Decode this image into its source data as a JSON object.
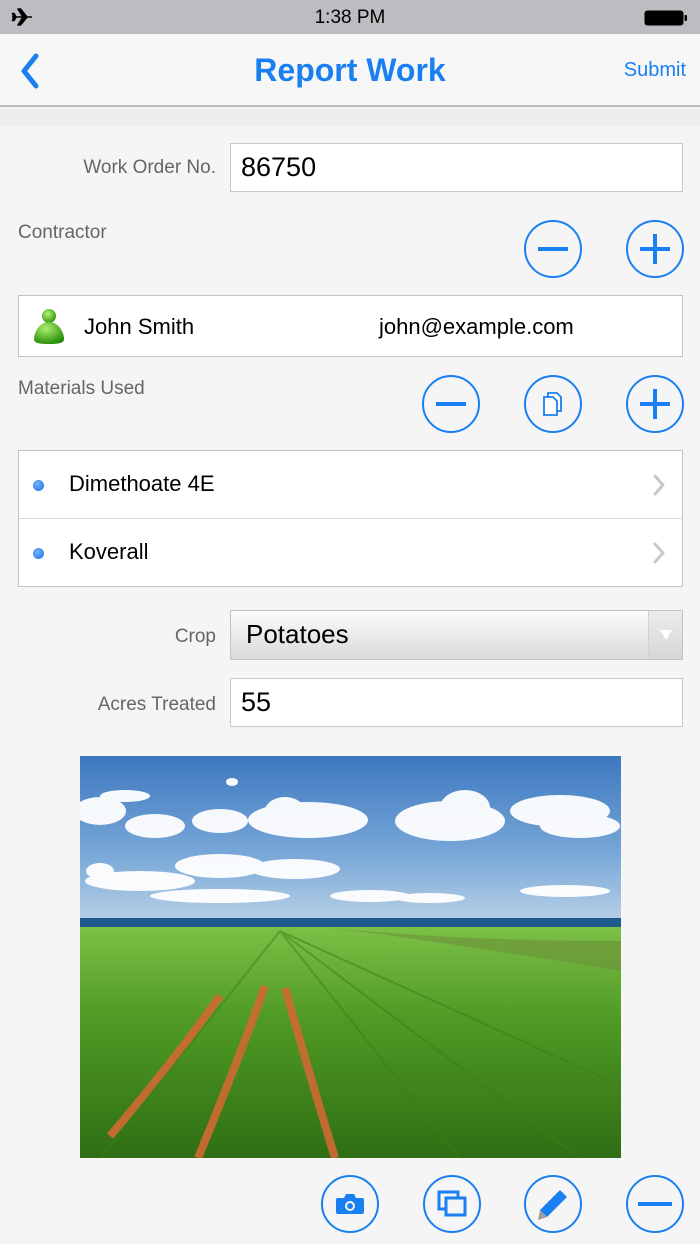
{
  "status_bar": {
    "time": "1:38 PM",
    "left_icon": "airplane-mode-icon",
    "right_icon": "battery-icon"
  },
  "nav": {
    "back_icon": "chevron-left-icon",
    "title": "Report Work",
    "submit_label": "Submit"
  },
  "form": {
    "work_order": {
      "label": "Work Order No.",
      "value": "86750"
    },
    "contractor": {
      "label": "Contractor",
      "buttons": [
        "minus-circle-icon",
        "plus-circle-icon"
      ],
      "entry": {
        "icon": "person-avatar-icon",
        "name": "John Smith",
        "email": "john@example.com"
      }
    },
    "materials": {
      "label": "Materials Used",
      "buttons": [
        "minus-circle-icon",
        "copy-circle-icon",
        "plus-circle-icon"
      ],
      "items": [
        {
          "name": "Dimethoate 4E"
        },
        {
          "name": "Koverall"
        }
      ]
    },
    "crop": {
      "label": "Crop",
      "selected": "Potatoes"
    },
    "acres": {
      "label": "Acres Treated",
      "value": "55"
    }
  },
  "photo": {
    "description": "Potato field rows under blue sky with clouds",
    "actions": [
      "camera-icon",
      "gallery-icon",
      "pencil-icon",
      "minus-circle-icon"
    ]
  },
  "colors": {
    "accent": "#1a7ff0",
    "background": "#f5f5f5",
    "status_bar": "#bdbdc1"
  }
}
